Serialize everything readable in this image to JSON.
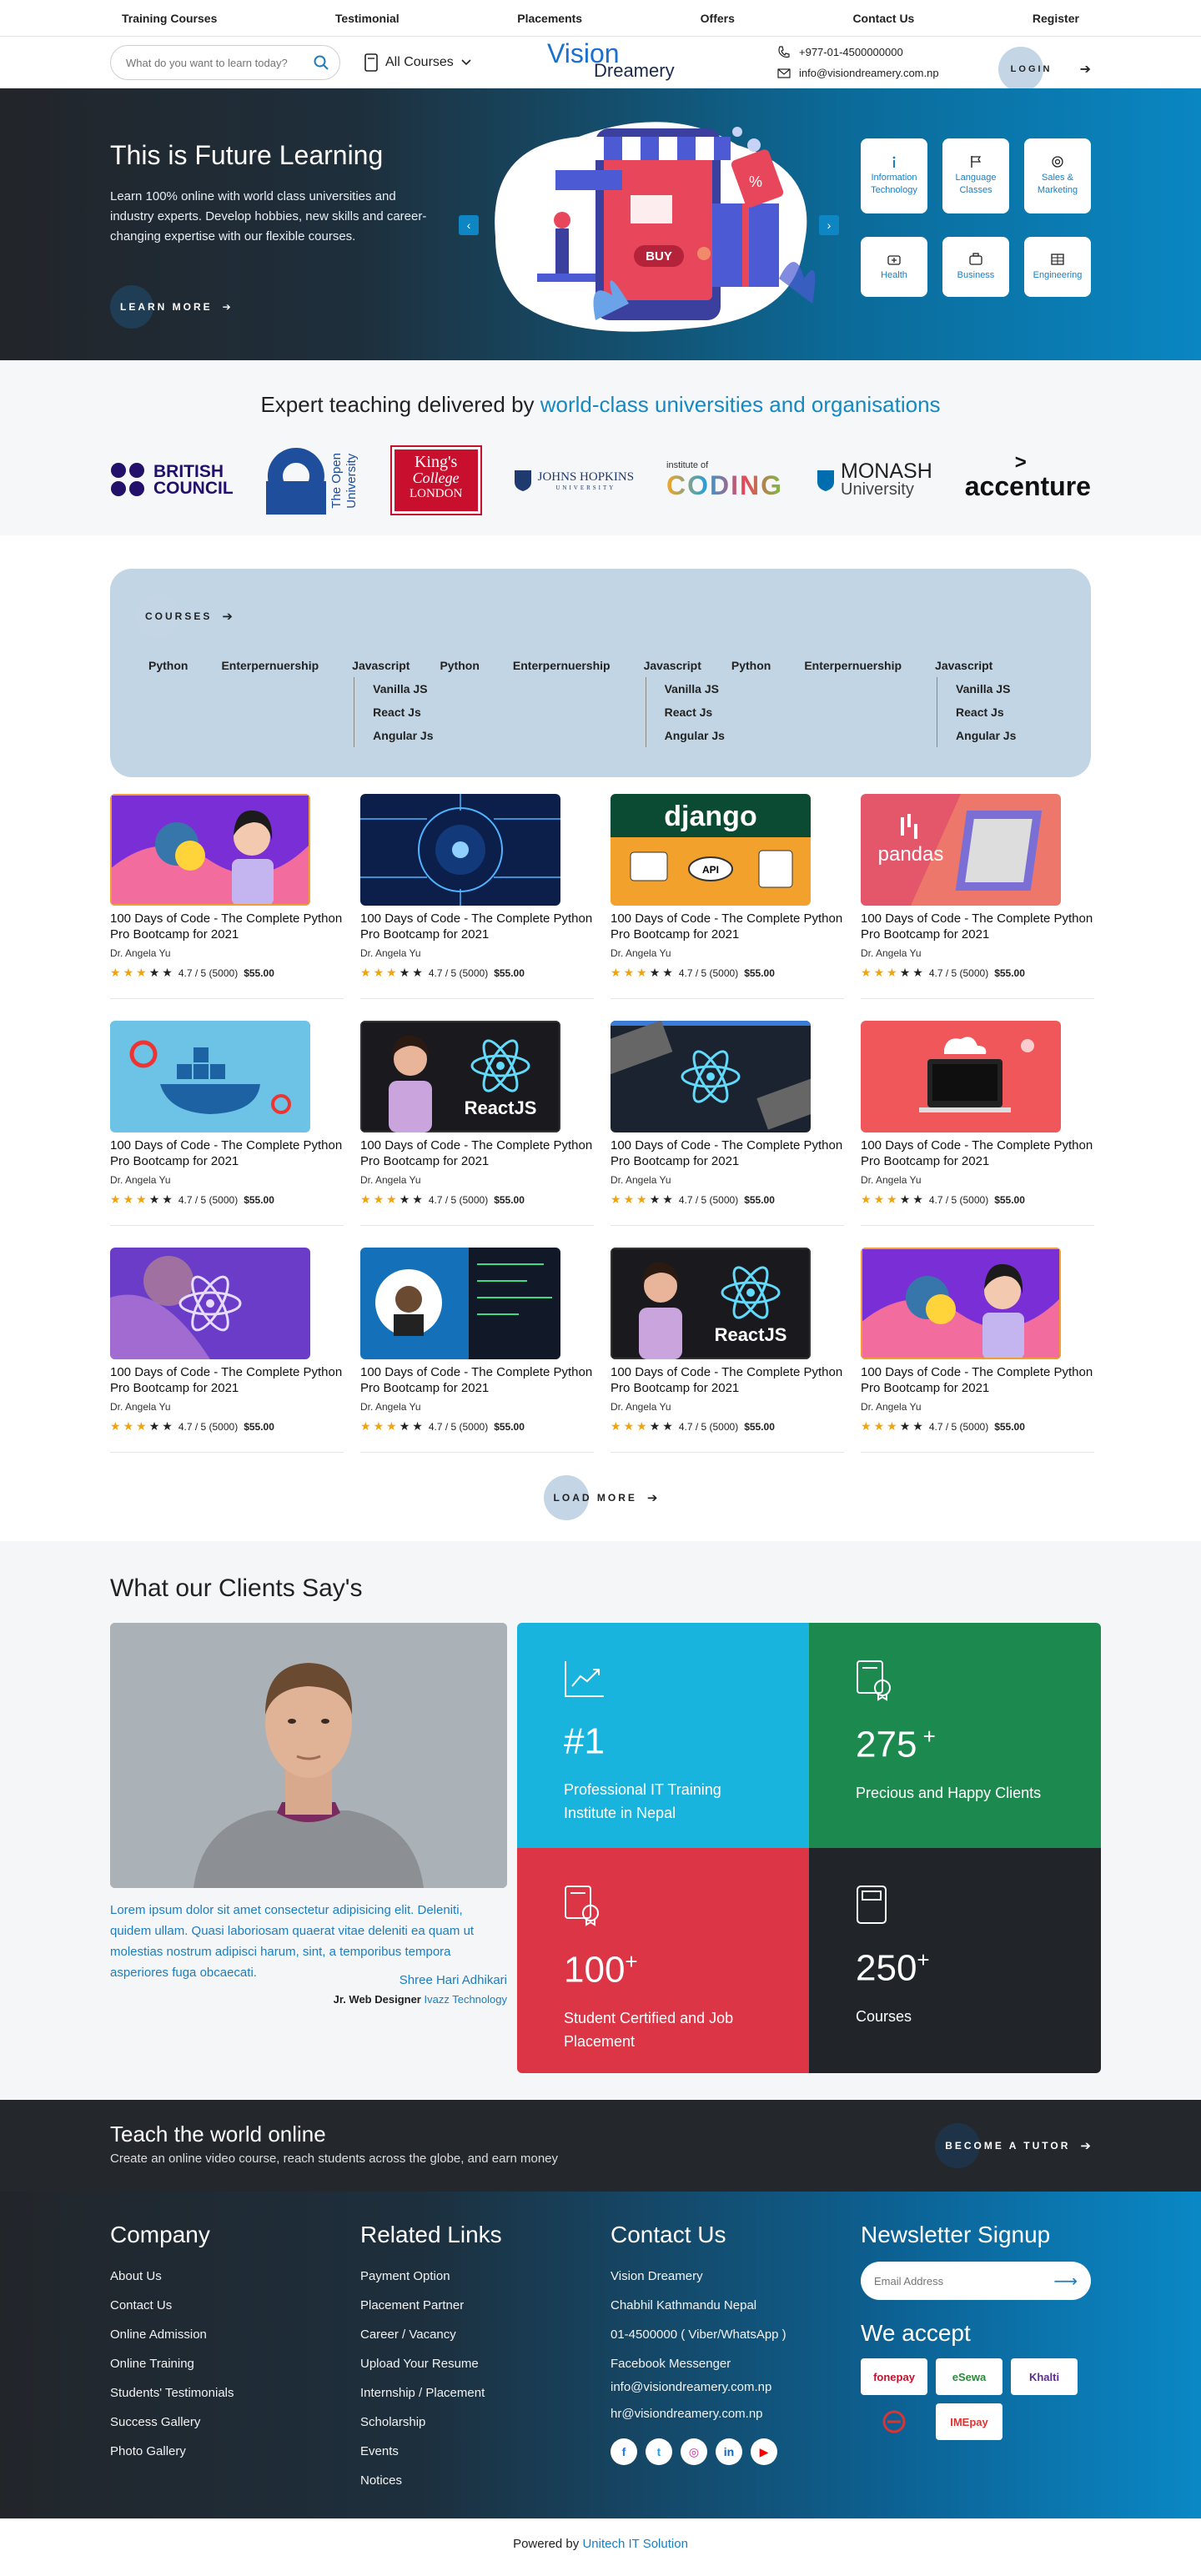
{
  "topnav": [
    "Training Courses",
    "Testimonial",
    "Placements",
    "Offers",
    "Contact Us",
    "Register"
  ],
  "header": {
    "search_placeholder": "What do you want to learn today?",
    "all_courses": "All Courses",
    "logo_main": "Vision",
    "logo_sub": "Dreamery",
    "phone": "+977-01-4500000000",
    "email": "info@visiondreamery.com.np",
    "login": "LOGIN"
  },
  "hero": {
    "title": "This is Future Learning",
    "text": "Learn 100% online with world class universities and industry experts. Develop hobbies, new skills and career-changing expertise with our flexible courses.",
    "cta": "LEARN MORE",
    "buy": "BUY",
    "categories": [
      "Information Technology",
      "Language Classes",
      "Sales & Marketing",
      "Health",
      "Business",
      "Engineering"
    ]
  },
  "partners": {
    "title_a": "Expert teaching delivered by ",
    "title_b": "world-class universities and organisations",
    "logos": {
      "british_council": [
        "BRITISH",
        "COUNCIL"
      ],
      "open_university": [
        "The Open",
        "University"
      ],
      "kings": [
        "King's",
        "College",
        "LONDON"
      ],
      "johns_hopkins": [
        "JOHNS HOPKINS",
        "UNIVERSITY"
      ],
      "coding": [
        "institute of",
        "CODING"
      ],
      "monash": [
        "MONASH",
        "University"
      ],
      "accenture": "accenture"
    }
  },
  "courses": {
    "button": "COURSES",
    "menu": [
      "Python",
      "Enterpernuership",
      "Javascript"
    ],
    "submenu": [
      "Vanilla JS",
      "React Js",
      "Angular Js"
    ],
    "cards": [
      {
        "thumb": "python-woman",
        "title": "100 Days of Code - The Complete Python Pro Bootcamp for 2021",
        "author": "Dr. Angela Yu",
        "rating": "4.7 / 5 (5000)",
        "price": "$55.00",
        "stars": 3
      },
      {
        "thumb": "circuit",
        "title": "100 Days of Code - The Complete Python Pro Bootcamp for 2021",
        "author": "Dr. Angela Yu",
        "rating": "4.7 / 5 (5000)",
        "price": "$55.00",
        "stars": 3
      },
      {
        "thumb": "django",
        "title": "100 Days of Code - The Complete Python Pro Bootcamp for 2021",
        "author": "Dr. Angela Yu",
        "rating": "4.7 / 5 (5000)",
        "price": "$55.00",
        "stars": 3
      },
      {
        "thumb": "pandas",
        "title": "100 Days of Code - The Complete Python Pro Bootcamp for 2021",
        "author": "Dr. Angela Yu",
        "rating": "4.7 / 5 (5000)",
        "price": "$55.00",
        "stars": 3
      },
      {
        "thumb": "docker",
        "title": "100 Days of Code - The Complete Python Pro Bootcamp for 2021",
        "author": "Dr. Angela Yu",
        "rating": "4.7 / 5 (5000)",
        "price": "$55.00",
        "stars": 3
      },
      {
        "thumb": "reactjs-woman",
        "title": "100 Days of Code - The Complete Python Pro Bootcamp for 2021",
        "author": "Dr. Angela Yu",
        "rating": "4.7 / 5 (5000)",
        "price": "$55.00",
        "stars": 3
      },
      {
        "thumb": "react-laptop",
        "title": "100 Days of Code - The Complete Python Pro Bootcamp for 2021",
        "author": "Dr. Angela Yu",
        "rating": "4.7 / 5 (5000)",
        "price": "$55.00",
        "stars": 3
      },
      {
        "thumb": "cloud-red",
        "title": "100 Days of Code - The Complete Python Pro Bootcamp for 2021",
        "author": "Dr. Angela Yu",
        "rating": "4.7 / 5 (5000)",
        "price": "$55.00",
        "stars": 3
      },
      {
        "thumb": "react-purple",
        "title": "100 Days of Code - The Complete Python Pro Bootcamp for 2021",
        "author": "Dr. Angela Yu",
        "rating": "4.7 / 5 (5000)",
        "price": "$55.00",
        "stars": 3
      },
      {
        "thumb": "dev-man",
        "title": "100 Days of Code - The Complete Python Pro Bootcamp for 2021",
        "author": "Dr. Angela Yu",
        "rating": "4.7 / 5 (5000)",
        "price": "$55.00",
        "stars": 3
      },
      {
        "thumb": "reactjs-woman",
        "title": "100 Days of Code - The Complete Python Pro Bootcamp for 2021",
        "author": "Dr. Angela Yu",
        "rating": "4.7 / 5 (5000)",
        "price": "$55.00",
        "stars": 3
      },
      {
        "thumb": "python-woman",
        "title": "100 Days of Code - The Complete Python Pro Bootcamp for 2021",
        "author": "Dr. Angela Yu",
        "rating": "4.7 / 5 (5000)",
        "price": "$55.00",
        "stars": 3
      }
    ],
    "load_more": "LOAD MORE"
  },
  "testimonials": {
    "title": "What our Clients Say's",
    "quote": "Lorem ipsum dolor sit amet consectetur adipisicing elit. Deleniti, quidem ullam. Quasi laboriosam quaerat vitae deleniti ea quam ut molestias nostrum adipisci harum, sint, a temporibus tempora asperiores fuga obcaecati.",
    "name": "Shree Hari Adhikari",
    "role": "Jr. Web Designer",
    "company": "Ivazz Technology",
    "stats": [
      {
        "num": "#1",
        "sup": "",
        "text": "Professional IT Training Institute in Nepal",
        "color": "#18b4de",
        "icon": "chart-icon"
      },
      {
        "num": "275",
        "sup": " +",
        "text": "Precious and Happy Clients",
        "color": "#1c8a4f",
        "icon": "certificate-icon"
      },
      {
        "num": "100",
        "sup": "+",
        "text": "Student Certified and Job Placement",
        "color": "#dc3545",
        "icon": "certificate-icon"
      },
      {
        "num": "250",
        "sup": "+",
        "text": "Courses",
        "color": "#212529",
        "icon": "book-icon"
      }
    ]
  },
  "tutor": {
    "title": "Teach the world online",
    "text": "Create an online video course, reach students across the globe, and earn money",
    "cta": "BECOME A TUTOR"
  },
  "footer": {
    "company": {
      "title": "Company",
      "links": [
        "About Us",
        "Contact Us",
        "Online Admission",
        "Online Training",
        "Students' Testimonials",
        "Success Gallery",
        "Photo Gallery"
      ]
    },
    "related": {
      "title": "Related Links",
      "links": [
        "Payment Option",
        "Placement Partner",
        "Career / Vacancy",
        "Upload Your Resume",
        "Internship / Placement",
        "Scholarship",
        "Events",
        "Notices"
      ]
    },
    "contact": {
      "title": "Contact Us",
      "lines": [
        "Vision Dreamery",
        "Chabhil Kathmandu Nepal",
        "01-4500000   ( Viber/WhatsApp )",
        "Facebook Messenger",
        "info@visiondreamery.com.np",
        "hr@visiondreamery.com.np"
      ]
    },
    "newsletter": {
      "title": "Newsletter Signup",
      "placeholder": "Email Address",
      "accept": "We accept"
    },
    "payments": [
      "fonepay",
      "eSewa",
      "Khalti",
      "bank",
      "IMEpay"
    ]
  },
  "powered": {
    "prefix": "Powered by ",
    "company": "Unitech IT Solution"
  }
}
